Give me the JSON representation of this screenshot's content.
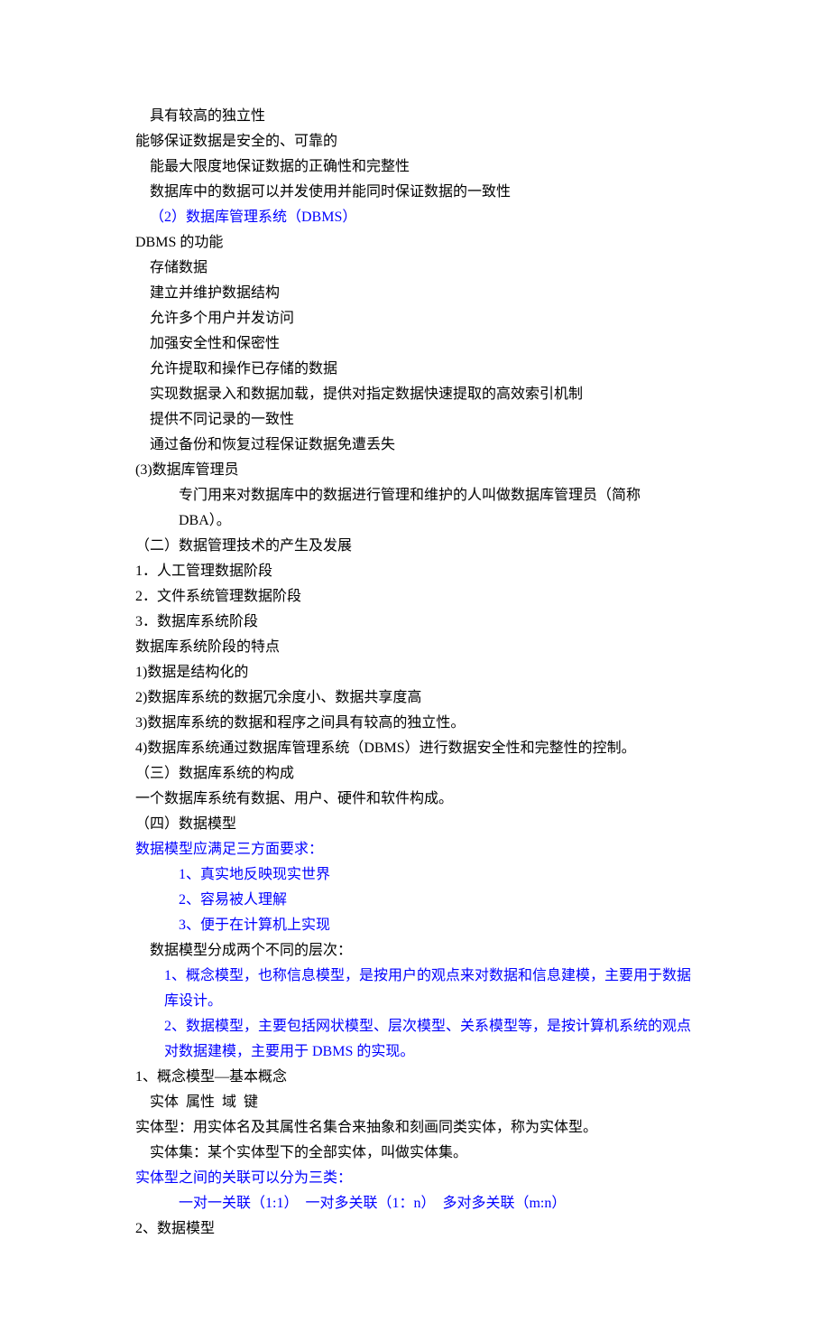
{
  "lines": [
    {
      "class": "i1",
      "text": "具有较高的独立性"
    },
    {
      "class": "",
      "text": "能够保证数据是安全的、可靠的"
    },
    {
      "class": "i1",
      "text": "能最大限度地保证数据的正确性和完整性"
    },
    {
      "class": "i1",
      "text": "数据库中的数据可以并发使用并能同时保证数据的一致性"
    },
    {
      "class": "i1 blue",
      "text": "（2）数据库管理系统（DBMS）"
    },
    {
      "class": "",
      "text": "DBMS 的功能"
    },
    {
      "class": "i1",
      "text": "存储数据"
    },
    {
      "class": "i1",
      "text": "建立并维护数据结构"
    },
    {
      "class": "i1",
      "text": "允许多个用户并发访问"
    },
    {
      "class": "i1",
      "text": "加强安全性和保密性"
    },
    {
      "class": "i1",
      "text": "允许提取和操作已存储的数据"
    },
    {
      "class": "i1",
      "text": "实现数据录入和数据加载，提供对指定数据快速提取的高效索引机制"
    },
    {
      "class": "i1",
      "text": "提供不同记录的一致性"
    },
    {
      "class": "i1",
      "text": "通过备份和恢复过程保证数据免遭丢失"
    },
    {
      "class": "",
      "text": "(3)数据库管理员"
    },
    {
      "class": "i3",
      "text": "专门用来对数据库中的数据进行管理和维护的人叫做数据库管理员（简称 DBA）。"
    },
    {
      "class": "",
      "text": "（二）数据管理技术的产生及发展"
    },
    {
      "class": "",
      "text": "1．人工管理数据阶段"
    },
    {
      "class": "",
      "text": "2．文件系统管理数据阶段"
    },
    {
      "class": "",
      "text": "3．数据库系统阶段"
    },
    {
      "class": "",
      "text": "数据库系统阶段的特点"
    },
    {
      "class": "",
      "text": "1)数据是结构化的"
    },
    {
      "class": "",
      "text": "2)数据库系统的数据冗余度小、数据共享度高"
    },
    {
      "class": "",
      "text": "3)数据库系统的数据和程序之间具有较高的独立性。"
    },
    {
      "class": "",
      "text": "4)数据库系统通过数据库管理系统（DBMS）进行数据安全性和完整性的控制。"
    },
    {
      "class": "",
      "text": "（三）数据库系统的构成"
    },
    {
      "class": "",
      "text": "一个数据库系统有数据、用户、硬件和软件构成。"
    },
    {
      "class": "",
      "text": "（四）数据模型"
    },
    {
      "class": "blue",
      "text": "数据模型应满足三方面要求："
    },
    {
      "class": "i3 blue",
      "text": "1、真实地反映现实世界"
    },
    {
      "class": "i3 blue",
      "text": "2、容易被人理解"
    },
    {
      "class": "i3 blue",
      "text": "3、便于在计算机上实现"
    },
    {
      "class": "i1",
      "text": "数据模型分成两个不同的层次："
    },
    {
      "class": "i2 blue",
      "text": "1、概念模型，也称信息模型，是按用户的观点来对数据和信息建模，主要用于数据库设计。"
    },
    {
      "class": "i2 blue",
      "text": "2、数据模型，主要包括网状模型、层次模型、关系模型等，是按计算机系统的观点对数据建模，主要用于 DBMS 的实现。"
    },
    {
      "class": "",
      "text": "1、概念模型—基本概念"
    },
    {
      "class": "i1",
      "text": "实体  属性  域  键"
    },
    {
      "class": "",
      "text": "实体型：用实体名及其属性名集合来抽象和刻画同类实体，称为实体型。"
    },
    {
      "class": "i1",
      "text": "实体集：某个实体型下的全部实体，叫做实体集。"
    },
    {
      "class": "blue",
      "text": "实体型之间的关联可以分为三类："
    },
    {
      "class": "i3 blue",
      "text": "一对一关联（1:1）  一对多关联（1：n）  多对多关联（m:n）"
    },
    {
      "class": "",
      "text": "2、数据模型"
    }
  ]
}
